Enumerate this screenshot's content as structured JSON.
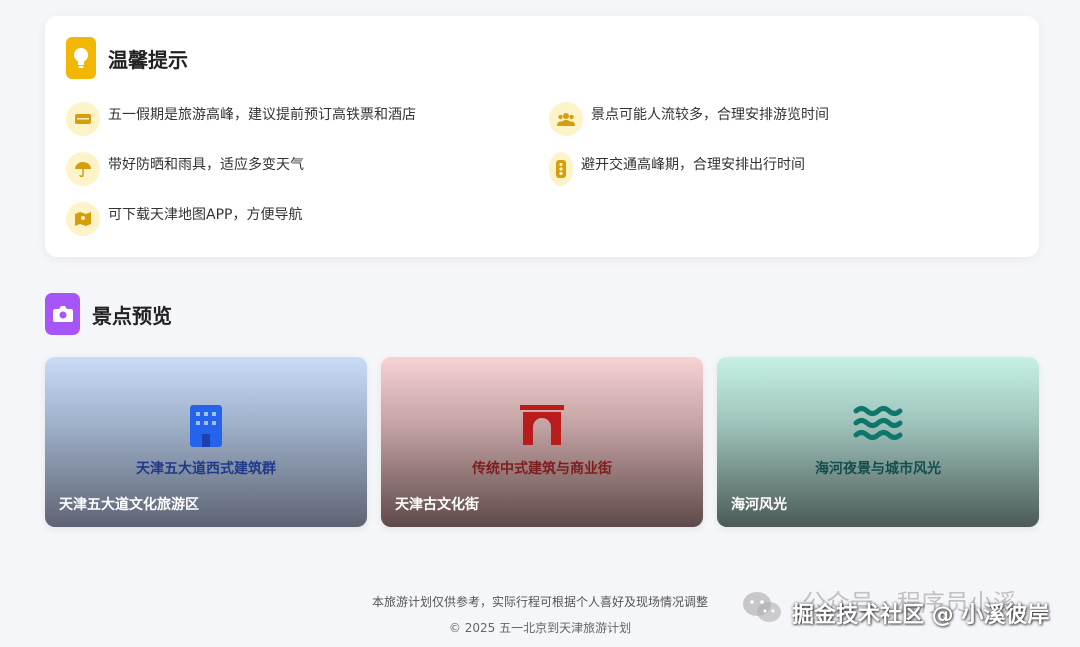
{
  "tips": {
    "title": "温馨提示",
    "items": [
      {
        "icon": "ticket-icon",
        "text": "五一假期是旅游高峰，建议提前预订高铁票和酒店"
      },
      {
        "icon": "people-icon",
        "text": "景点可能人流较多，合理安排游览时间"
      },
      {
        "icon": "umbrella-icon",
        "text": "带好防晒和雨具，适应多变天气"
      },
      {
        "icon": "traffic-light-icon",
        "text": "避开交通高峰期，合理安排出行时间"
      },
      {
        "icon": "map-icon",
        "text": "可下载天津地图APP，方便导航"
      }
    ]
  },
  "preview": {
    "title": "景点预览",
    "spots": [
      {
        "icon": "building-icon",
        "subtitle": "天津五大道西式建筑群",
        "name": "天津五大道文化旅游区",
        "color": "#2563eb"
      },
      {
        "icon": "gate-icon",
        "subtitle": "传统中式建筑与商业街",
        "name": "天津古文化街",
        "color": "#b91c1c"
      },
      {
        "icon": "water-icon",
        "subtitle": "海河夜景与城市风光",
        "name": "海河风光",
        "color": "#0f766e"
      }
    ]
  },
  "footer": {
    "note": "本旅游计划仅供参考，实际行程可根据个人喜好及现场情况调整",
    "copyright": "© 2025 五一北京到天津旅游计划"
  },
  "watermark": {
    "line1": "公众号 · 程序员小溪",
    "line2": "掘金技术社区 @ 小溪彼岸"
  },
  "colors": {
    "tip_accent": "#f2b705",
    "preview_accent": "#a855f7"
  }
}
